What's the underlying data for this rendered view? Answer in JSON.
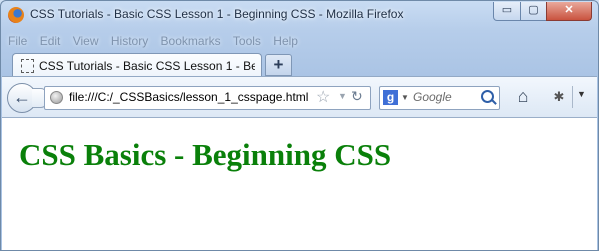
{
  "window": {
    "title": "CSS Tutorials - Basic CSS Lesson 1 - Beginning CSS - Mozilla Firefox",
    "controls": {
      "minimize": "▭",
      "maximize": "▢",
      "close": "✕"
    }
  },
  "menubar": {
    "items": [
      "File",
      "Edit",
      "View",
      "History",
      "Bookmarks",
      "Tools",
      "Help"
    ]
  },
  "tabs": [
    {
      "label": "CSS Tutorials - Basic CSS Lesson 1 - Begi...",
      "icon": "page-icon"
    }
  ],
  "newtab": {
    "label": "+"
  },
  "navbar": {
    "back_icon": "←",
    "url": "file:///C:/_CSSBasics/lesson_1_csspage.html",
    "star_icon": "☆",
    "dropmarker_icon": "▼",
    "reload_icon": "↻",
    "search": {
      "engine": "g",
      "placeholder": "Google"
    },
    "home_icon": "⌂",
    "addon_icon": "✱",
    "menu_arrow": "▼"
  },
  "page": {
    "heading": "CSS Basics - Beginning CSS",
    "heading_color": "#0a800a"
  }
}
